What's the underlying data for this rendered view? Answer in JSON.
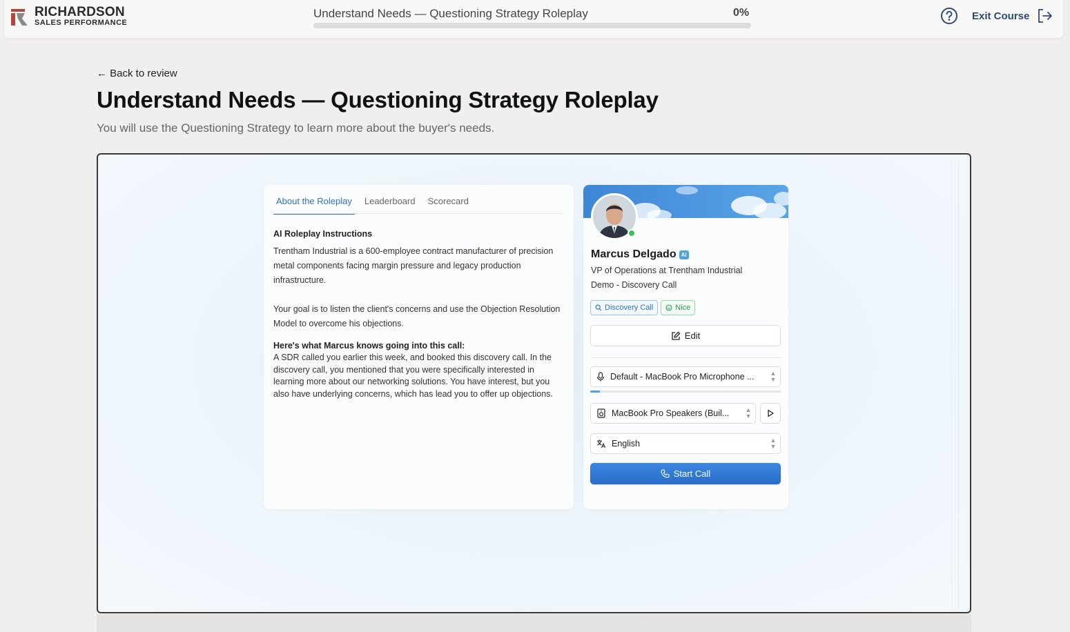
{
  "brand": {
    "name": "RICHARDSON",
    "subtitle": "SALES PERFORMANCE"
  },
  "header": {
    "course_title": "Understand Needs — Questioning Strategy Roleplay",
    "progress_label": "0%",
    "progress_fraction": 0.0,
    "exit_label": "Exit Course"
  },
  "page": {
    "back_label": "← Back to review",
    "title": "Understand Needs — Questioning Strategy Roleplay",
    "subtitle": "You will use the Questioning Strategy to learn more about the buyer's needs."
  },
  "roleplay": {
    "tabs": [
      "About the Roleplay",
      "Leaderboard",
      "Scorecard"
    ],
    "active_tab": 0,
    "instructions_heading": "AI Roleplay Instructions",
    "paragraph1": "Trentham Industrial is a 600-employee contract manufacturer of precision metal components facing margin pressure and legacy production infrastructure.",
    "paragraph2": "Your goal is to listen the client's concerns and use the Objection Resolution Model to overcome his objections.",
    "knows_heading": "Here's what Marcus knows going into this call:",
    "knows_text": "A SDR called you earlier this week, and booked this discovery call. In the discovery call, you mentioned that you were specifically interested in learning more about our networking solutions. You have interest, but you also have underlying concerns, which has lead you to offer up objections."
  },
  "persona": {
    "name": "Marcus Delgado",
    "ai_badge": "AI",
    "role": "VP of Operations at Trentham Industrial",
    "demo": "Demo - Discovery Call",
    "chips": [
      {
        "label": "Discovery Call",
        "color": "#2f72c4"
      },
      {
        "label": "Nice",
        "color": "#2e9a4f"
      }
    ],
    "edit_label": "Edit",
    "microphone": "Default - MacBook Pro Microphone ...",
    "mic_level_fraction": 0.05,
    "speaker": "MacBook Pro Speakers (Buil...",
    "language": "English",
    "start_label": "Start Call"
  },
  "colors": {
    "accent": "#2f72c4",
    "online": "#3bbf5f"
  }
}
